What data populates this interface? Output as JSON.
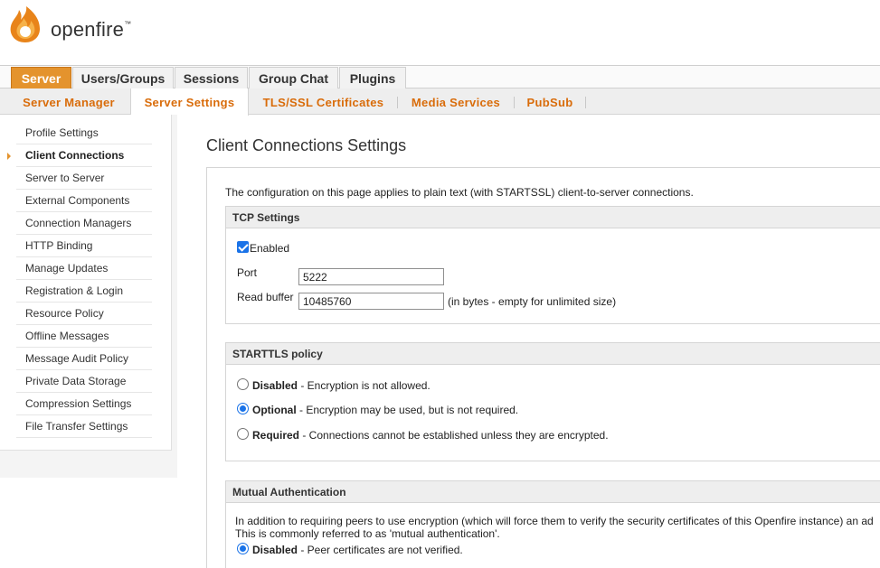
{
  "brand": {
    "name": "openfire",
    "tm": "™"
  },
  "main_tabs": [
    {
      "label": "Server",
      "active": true
    },
    {
      "label": "Users/Groups",
      "active": false
    },
    {
      "label": "Sessions",
      "active": false
    },
    {
      "label": "Group Chat",
      "active": false
    },
    {
      "label": "Plugins",
      "active": false
    }
  ],
  "sub_tabs": [
    {
      "label": "Server Manager",
      "active": false
    },
    {
      "label": "Server Settings",
      "active": true
    },
    {
      "label": "TLS/SSL Certificates",
      "active": false
    },
    {
      "label": "Media Services",
      "active": false
    },
    {
      "label": "PubSub",
      "active": false
    }
  ],
  "sidebar": {
    "items": [
      {
        "label": "Profile Settings",
        "active": false
      },
      {
        "label": "Client Connections",
        "active": true
      },
      {
        "label": "Server to Server",
        "active": false
      },
      {
        "label": "External Components",
        "active": false
      },
      {
        "label": "Connection Managers",
        "active": false
      },
      {
        "label": "HTTP Binding",
        "active": false
      },
      {
        "label": "Manage Updates",
        "active": false
      },
      {
        "label": "Registration & Login",
        "active": false
      },
      {
        "label": "Resource Policy",
        "active": false
      },
      {
        "label": "Offline Messages",
        "active": false
      },
      {
        "label": "Message Audit Policy",
        "active": false
      },
      {
        "label": "Private Data Storage",
        "active": false
      },
      {
        "label": "Compression Settings",
        "active": false
      },
      {
        "label": "File Transfer Settings",
        "active": false
      }
    ]
  },
  "page": {
    "title": "Client Connections Settings",
    "intro": "The configuration on this page applies to plain text (with STARTSSL) client-to-server connections."
  },
  "tcp": {
    "header": "TCP Settings",
    "enabled_label": "Enabled",
    "enabled": true,
    "port_label": "Port",
    "port_value": "5222",
    "buffer_label": "Read buffer",
    "buffer_value": "10485760",
    "buffer_hint": "(in bytes - empty for unlimited size)"
  },
  "starttls": {
    "header": "STARTTLS policy",
    "options": [
      {
        "label": "Disabled",
        "desc": " - Encryption is not allowed.",
        "selected": false
      },
      {
        "label": "Optional",
        "desc": " - Encryption may be used, but is not required.",
        "selected": true
      },
      {
        "label": "Required",
        "desc": " - Connections cannot be established unless they are encrypted.",
        "selected": false
      }
    ]
  },
  "mutual": {
    "header": "Mutual Authentication",
    "line1": "In addition to requiring peers to use encryption (which will force them to verify the security certificates of this Openfire instance) an ad",
    "line2": "This is commonly referred to as 'mutual authentication'.",
    "option_label": "Disabled",
    "option_desc": " - Peer certificates are not verified.",
    "option_selected": true
  },
  "colors": {
    "accent": "#e4932d",
    "subtab_text": "#d96c0a",
    "radio": "#1a73e8"
  }
}
